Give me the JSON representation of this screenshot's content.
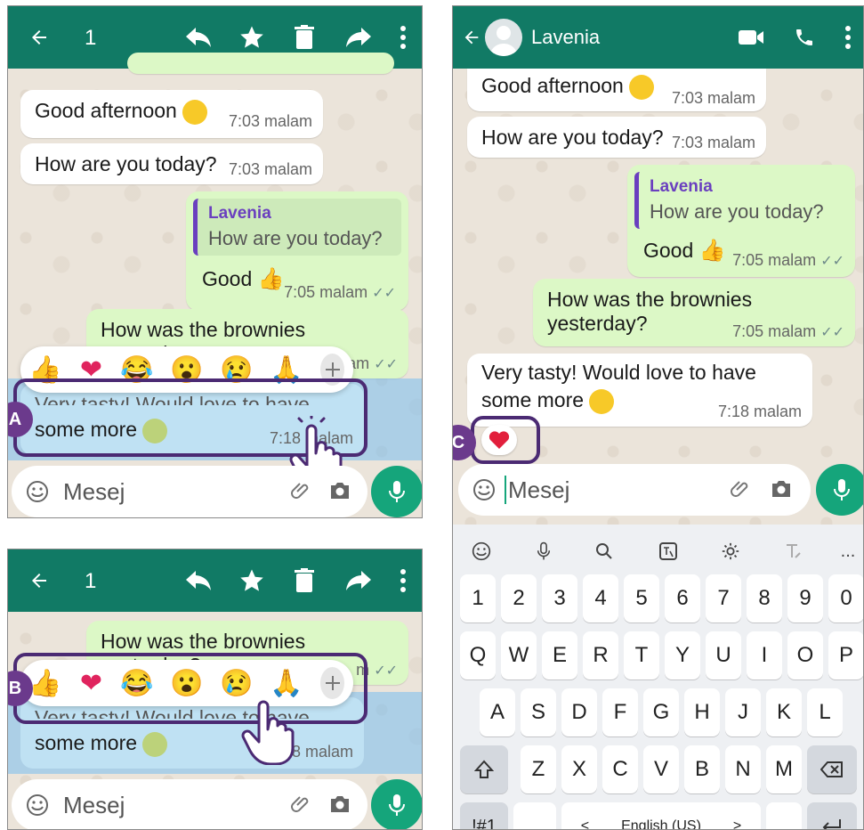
{
  "common": {
    "selected_count": "1",
    "input_placeholder": "Mesej"
  },
  "panel_a": {
    "marker": "A",
    "messages": {
      "m1_text": "Good afternoon",
      "m1_time": "7:03 malam",
      "m2_text": "How are you today?",
      "m2_time": "7:03 malam",
      "reply_name": "Lavenia",
      "reply_quote": "How are you today?",
      "reply_text": "Good",
      "reply_time": "7:05 malam",
      "m4_text": "How was the brownies yesterday?",
      "m4_time_partial": "lam",
      "m5_text_top": "Very tasty! Would love to have",
      "m5_text_bottom": "some more",
      "m5_time": "7:18 malam"
    }
  },
  "panel_b": {
    "marker": "B",
    "m4_text": "How was the brownies yesterday?",
    "m4_time_partial": "m",
    "m5_text_top": "Very tasty! Would love to have",
    "m5_text_bottom": "some more",
    "m5_time_partial": "8 malam"
  },
  "panel_c": {
    "marker": "C",
    "contact_name": "Lavenia",
    "m1_text": "Good afternoon",
    "m1_time": "7:03 malam",
    "m2_text": "How are you today?",
    "m2_time": "7:03 malam",
    "reply_name": "Lavenia",
    "reply_quote": "How are you today?",
    "reply_text": "Good",
    "reply_time": "7:05 malam",
    "m4_text": "How was the brownies yesterday?",
    "m4_time": "7:05 malam",
    "m5_text_line1": "Very tasty! Would love to have",
    "m5_text_line2": "some more",
    "m5_time": "7:18 malam",
    "keyboard": {
      "row_numbers": [
        "1",
        "2",
        "3",
        "4",
        "5",
        "6",
        "7",
        "8",
        "9",
        "0"
      ],
      "row1": [
        "Q",
        "W",
        "E",
        "R",
        "T",
        "Y",
        "U",
        "I",
        "O",
        "P"
      ],
      "row2": [
        "A",
        "S",
        "D",
        "F",
        "G",
        "H",
        "J",
        "K",
        "L"
      ],
      "row3": [
        "Z",
        "X",
        "C",
        "V",
        "B",
        "N",
        "M"
      ],
      "symbols_key": "!#1",
      "language": "English (US)",
      "lang_prev": "<",
      "lang_next": ">",
      "more_tools": "..."
    }
  },
  "colors": {
    "header": "#117a65",
    "incoming_bubble": "#ffffff",
    "outgoing_bubble": "#dcf8c6",
    "highlight": "#4b2a73",
    "marker": "#6b3a8c",
    "mic": "#15a57b",
    "selection": "#a9d4f0"
  }
}
